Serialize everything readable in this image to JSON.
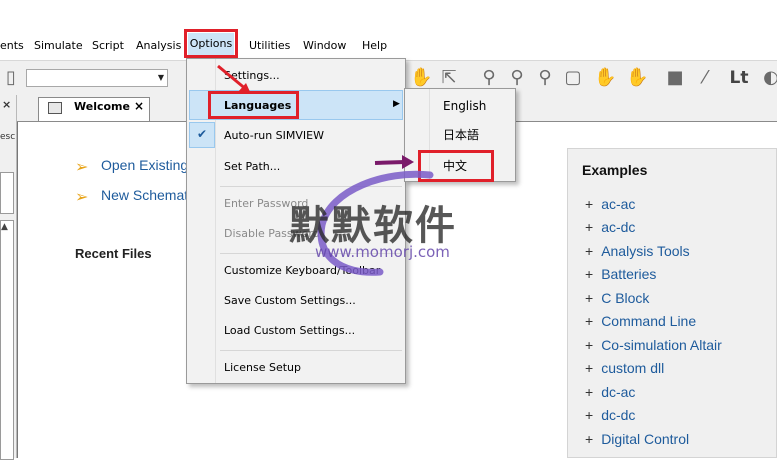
{
  "menubar": {
    "items": [
      "ents",
      "Simulate",
      "Script",
      "Analysis",
      "Options",
      "Utilities",
      "Window",
      "Help"
    ]
  },
  "tab": {
    "label": "Welcome",
    "close": "×"
  },
  "left_panel": {
    "close": "×",
    "desc": "esc"
  },
  "welcome": {
    "links": [
      "Open Existing",
      "New Schemat"
    ],
    "recent_title": "Recent Files"
  },
  "examples": {
    "title": "Examples",
    "items": [
      "ac-ac",
      "ac-dc",
      "Analysis Tools",
      "Batteries",
      "C Block",
      "Command Line",
      "Co-simulation Altair",
      "custom dll",
      "dc-ac",
      "dc-dc",
      "Digital Control"
    ]
  },
  "options_menu": {
    "items": [
      "Settings...",
      "Languages",
      "Auto-run SIMVIEW",
      "Set Path...",
      "Enter Password",
      "Disable Password",
      "Customize Keyboard/Toolbar",
      "Save Custom Settings...",
      "Load Custom Settings...",
      "License Setup"
    ]
  },
  "languages_menu": {
    "items": [
      "English",
      "日本語",
      "中文"
    ]
  },
  "toolbar": {
    "lt_label": "Lt"
  },
  "watermark": {
    "text": "默默软件",
    "url": "www.momorj.com"
  },
  "colors": {
    "highlight": "#e0202a",
    "accent": "#1e5b9c",
    "menu_hover": "#cce4f7",
    "arrow": "#7a1a6a"
  }
}
